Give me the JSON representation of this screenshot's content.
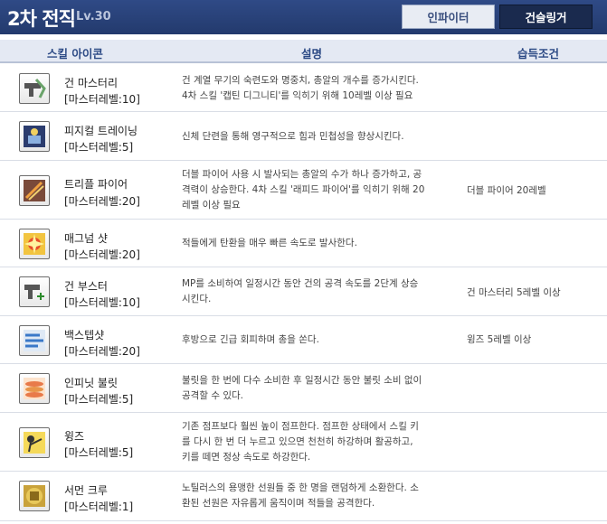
{
  "header": {
    "title": "2차 전직",
    "level": "Lv.30",
    "tabs": [
      {
        "label": "인파이터",
        "active": false
      },
      {
        "label": "건슬링거",
        "active": true
      }
    ]
  },
  "columns": {
    "icon": "스킬 아이콘",
    "desc": "설명",
    "cond": "습득조건"
  },
  "skills": [
    {
      "name": "건 마스터리",
      "level": "[마스터레벨:10]",
      "desc": [
        "건 계열 무기의 숙련도와 명중치, 총알의 개수를 증가시킨다.",
        "4차 스킬 '캡틴 디그니티'를 익히기 위해 10레벨 이상 필요"
      ],
      "cond": "",
      "icon": "gun-mastery-icon"
    },
    {
      "name": "피지컬 트레이닝",
      "level": "[마스터레벨:5]",
      "desc": [
        "신체 단련을 통해 영구적으로 힘과 민첩성을 향상시킨다."
      ],
      "cond": "",
      "icon": "physical-training-icon"
    },
    {
      "name": "트리플 파이어",
      "level": "[마스터레벨:20]",
      "desc": [
        "더블 파이어 사용 시 발사되는 총알의 수가 하나 증가하고, 공",
        "격력이 상승한다. 4차 스킬 '래피드 파이어'를 익히기 위해 20",
        "레벨 이상 필요"
      ],
      "cond": "더블 파이어 20레벨",
      "icon": "triple-fire-icon"
    },
    {
      "name": "매그넘 샷",
      "level": "[마스터레벨:20]",
      "desc": [
        "적들에게 탄환을 매우 빠른 속도로 발사한다."
      ],
      "cond": "",
      "icon": "magnum-shot-icon"
    },
    {
      "name": "건 부스터",
      "level": "[마스터레벨:10]",
      "desc": [
        "MP를 소비하여 일정시간 동안 건의 공격 속도를 2단계 상승",
        "시킨다."
      ],
      "cond": "건 마스터리 5레벨 이상",
      "icon": "gun-booster-icon"
    },
    {
      "name": "백스텝샷",
      "level": "[마스터레벨:20]",
      "desc": [
        "후방으로 긴급 회피하며 총을 쏜다."
      ],
      "cond": "윙즈 5레벨 이상",
      "icon": "backstep-shot-icon"
    },
    {
      "name": "인피닛 불릿",
      "level": "[마스터레벨:5]",
      "desc": [
        "불릿을 한 번에 다수 소비한 후 일정시간 동안 불릿 소비 없이",
        "공격할 수 있다."
      ],
      "cond": "",
      "icon": "infinite-bullet-icon"
    },
    {
      "name": "윙즈",
      "level": "[마스터레벨:5]",
      "desc": [
        "기존 점프보다 훨씬 높이 점프한다. 점프한 상태에서 스킬 키",
        "를 다시 한 번 더 누르고 있으면 천천히 하강하며 활공하고,",
        "키를 떼면 정상 속도로 하강한다."
      ],
      "cond": "",
      "icon": "wings-icon"
    },
    {
      "name": "서먼 크루",
      "level": "[마스터레벨:1]",
      "desc": [
        "노틸러스의 용맹한 선원들 중 한 명을 랜덤하게 소환한다. 소",
        "환된 선원은 자유롭게 움직이며 적들을 공격한다."
      ],
      "cond": "",
      "icon": "summon-crew-icon"
    }
  ]
}
